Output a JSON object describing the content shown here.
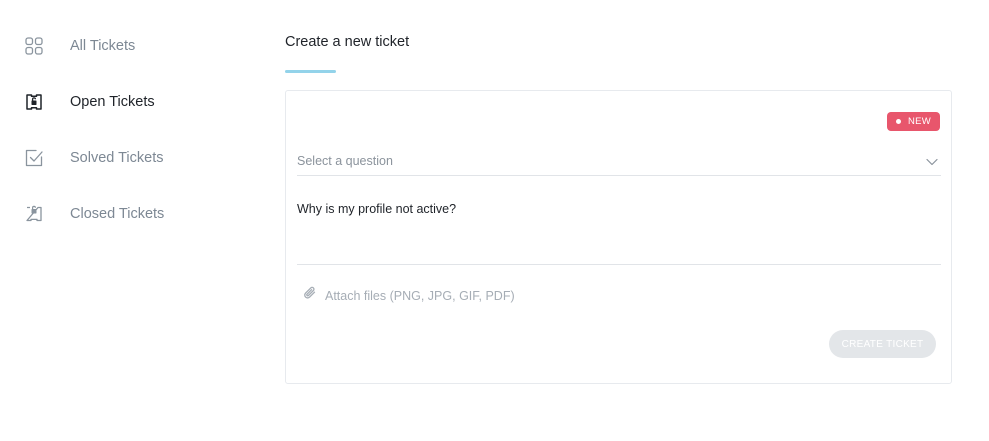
{
  "sidebar": {
    "items": [
      {
        "label": "All Tickets",
        "icon": "grid-icon",
        "active": false
      },
      {
        "label": "Open Tickets",
        "icon": "open-ticket-icon",
        "active": true
      },
      {
        "label": "Solved Tickets",
        "icon": "check-square-icon",
        "active": false
      },
      {
        "label": "Closed Tickets",
        "icon": "closed-ticket-icon",
        "active": false
      }
    ]
  },
  "main": {
    "title": "Create a new ticket",
    "badge": "NEW",
    "question_select": {
      "placeholder": "Select a question"
    },
    "message": {
      "value": "Why is my profile not active?"
    },
    "attach_label": "Attach files (PNG, JPG, GIF, PDF)",
    "create_button": "CREATE TICKET"
  },
  "colors": {
    "accent_underline": "#93d3ea",
    "badge": "#e8566c",
    "button_disabled": "#e3e6e9",
    "muted_text": "#7d8894"
  }
}
